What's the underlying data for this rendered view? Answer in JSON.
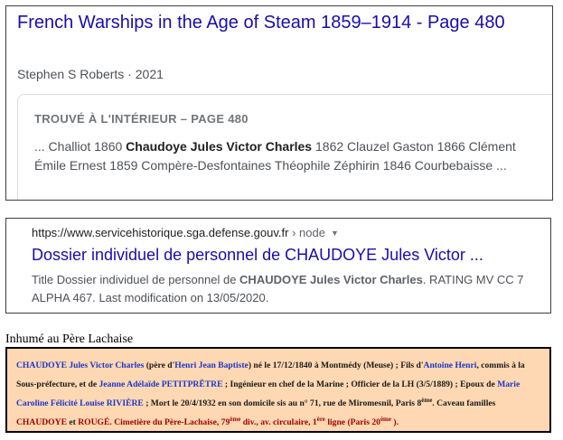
{
  "book": {
    "title": "French Warships in the Age of Steam 1859–1914 - Page 480",
    "author": "Stephen S Roberts",
    "separator": " · ",
    "year": "2021",
    "snippet_heading": "TROUVÉ À L'INTÉRIEUR – PAGE 480",
    "snippet_pre": "... Challiot 1860 ",
    "snippet_bold": "Chaudoye Jules Victor Charles",
    "snippet_post": " 1862 Clauzel Gaston 1866 Clément Émile Ernest 1859 Compère-Desfontaines Théophile Zéphirin 1846 Courbebaisse ..."
  },
  "web": {
    "url": "https://www.servicehistorique.sga.defense.gouv.fr",
    "breadcrumb": " › node",
    "title": "Dossier individuel de personnel de CHAUDOYE Jules Victor ...",
    "snippet_pre": "Title Dossier individuel de personnel de ",
    "snippet_bold": "CHAUDOYE Jules Victor Charles",
    "snippet_post": ". RATING MV CC 7 ALPHA 467. Last modification on 13/05/2020."
  },
  "caption": "Inhumé au Père Lachaise",
  "grave": {
    "t1": "CHAUDOYE Jules Victor Charles",
    "t2": " (père d'",
    "t3": "Henri Jean Baptiste",
    "t4": ") né le 17/12/1840 à Montmédy (Meuse) ; Fils d'",
    "t5": "Antoine Henri",
    "t6": ", commis à la Sous-préfecture, et de ",
    "t7": "Jeanne Adélaïde PETITPRÊTRE",
    "t8": " ; Ingénieur en chef de la Marine ; Officier de la LH (3/5/1889) ; Epoux de ",
    "t9": "Marie Caroline Félicité Louise RIVIÈRE",
    "t10": " ; Mort le 20/4/1932 en son domicile sis au n° 71, rue de Miromesnil, Paris 8",
    "sup1": "ème",
    "t11": ". Caveau familles ",
    "t12": "CHAUDOYE",
    "t13": " et ",
    "t14": "ROUGÉ",
    "t15": ". Cimetière du Père-Lachaise, 79",
    "sup2": "ème",
    "t16": "  div., av. circulaire, 1",
    "sup3": "ère",
    "t17": " ligne (Paris 20",
    "sup4": "ème",
    "t18": " )."
  }
}
